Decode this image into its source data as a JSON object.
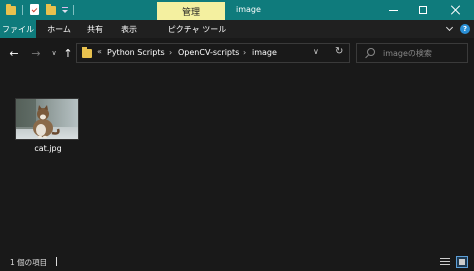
{
  "window": {
    "manage_tab": "管理",
    "title": "image"
  },
  "ribbon": {
    "tabs": [
      "ファイル",
      "ホーム",
      "共有",
      "表示",
      "ピクチャ ツール"
    ]
  },
  "nav": {
    "back": "←",
    "forward": "→",
    "recent": "∨",
    "up": "↑",
    "overflow": "«",
    "breadcrumb": [
      "Python Scripts",
      "OpenCV-scripts",
      "image"
    ],
    "separator": "›",
    "dropdown": "∨",
    "refresh": "↻"
  },
  "search": {
    "placeholder": "imageの検索"
  },
  "files": [
    {
      "name": "cat.jpg"
    }
  ],
  "status": {
    "item_count": "1 個の項目"
  },
  "colors": {
    "titlebar": "#0f7b7c",
    "manage_tab": "#f4f0a0",
    "background": "#191919",
    "folder": "#e8c14e"
  }
}
